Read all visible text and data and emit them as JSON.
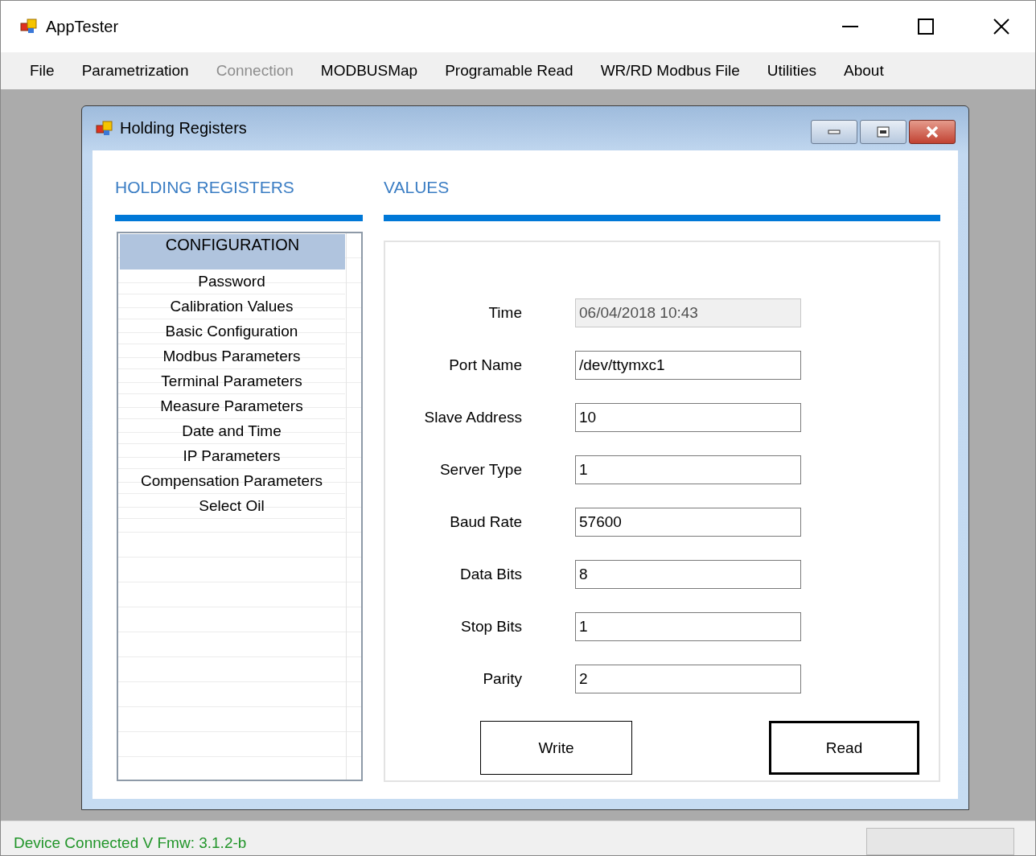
{
  "window": {
    "title": "AppTester"
  },
  "menu": [
    {
      "label": "File",
      "disabled": false
    },
    {
      "label": "Parametrization",
      "disabled": false
    },
    {
      "label": "Connection",
      "disabled": true
    },
    {
      "label": "MODBUSMap",
      "disabled": false
    },
    {
      "label": "Programable Read",
      "disabled": false
    },
    {
      "label": "WR/RD Modbus File",
      "disabled": false
    },
    {
      "label": "Utilities",
      "disabled": false
    },
    {
      "label": "About",
      "disabled": false
    }
  ],
  "child_window": {
    "title": "Holding Registers",
    "left_heading": "HOLDING REGISTERS",
    "right_heading": "VALUES",
    "list": {
      "header": "CONFIGURATION",
      "items": [
        {
          "label": "Password",
          "selected": false
        },
        {
          "label": "Calibration Values",
          "selected": false
        },
        {
          "label": "Basic Configuration",
          "selected": false
        },
        {
          "label": "Modbus Parameters",
          "selected": false
        },
        {
          "label": "Terminal Parameters",
          "selected": false
        },
        {
          "label": "Measure Parameters",
          "selected": false
        },
        {
          "label": "Date and Time",
          "selected": false
        },
        {
          "label": "IP Parameters",
          "selected": false
        },
        {
          "label": "Compensation Parameters",
          "selected": false
        },
        {
          "label": "Select Oil",
          "selected": false
        }
      ]
    },
    "fields": [
      {
        "label": "Time",
        "value": "06/04/2018 10:43",
        "disabled": true
      },
      {
        "label": "Port Name",
        "value": "/dev/ttymxc1",
        "disabled": false
      },
      {
        "label": "Slave Address",
        "value": "10",
        "disabled": false
      },
      {
        "label": "Server Type",
        "value": "1",
        "disabled": false
      },
      {
        "label": "Baud Rate",
        "value": "57600",
        "disabled": false
      },
      {
        "label": "Data Bits",
        "value": "8",
        "disabled": false
      },
      {
        "label": "Stop Bits",
        "value": "1",
        "disabled": false
      },
      {
        "label": "Parity",
        "value": "2",
        "disabled": false
      }
    ],
    "buttons": [
      {
        "label": "Write",
        "default": false
      },
      {
        "label": "Read",
        "default": true
      }
    ]
  },
  "status_bar": {
    "text": "Device Connected V Fmw: 3.1.2-b"
  }
}
